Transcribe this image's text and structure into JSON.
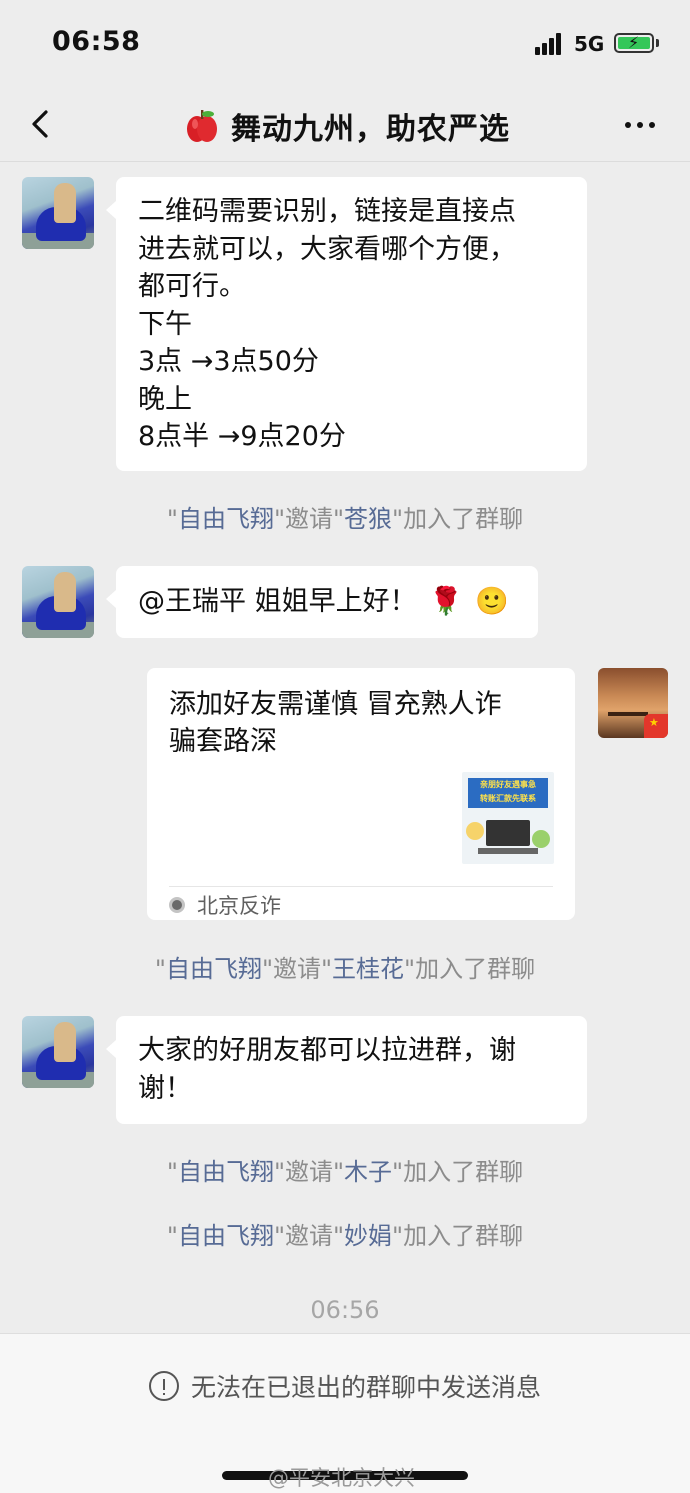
{
  "status_bar": {
    "time": "06:58",
    "network": "5G"
  },
  "nav": {
    "title": "舞动九州，助农严选"
  },
  "messages": {
    "m1_text": "二维码需要识别，链接是直接点\n进去就可以，大家看哪个方便，\n都可行。\n下午\n3点 →3点50分\n晚上\n8点半 →9点20分",
    "m2_text": "@王瑞平 姐姐早上好！",
    "m3_text": "大家的好朋友都可以拉进群，谢\n谢！"
  },
  "system_messages": [
    {
      "inviter": "自由飞翔",
      "invitee": "苍狼"
    },
    {
      "inviter": "自由飞翔",
      "invitee": "王桂花"
    },
    {
      "inviter": "自由飞翔",
      "invitee": "木子"
    },
    {
      "inviter": "自由飞翔",
      "invitee": "妙娟"
    }
  ],
  "system_text": {
    "quote": "\"",
    "invited": "邀请",
    "joined": "加入了群聊"
  },
  "card": {
    "title": "添加好友需谨慎 冒充熟人诈\n骗套路深",
    "source": "北京反诈",
    "thumb_text": "亲朋好友遇事急\n转账汇款先联系"
  },
  "timestamp": "06:56",
  "notice": "无法在已退出的群聊中发送消息",
  "watermark": "@平安北京大兴",
  "emoji": {
    "rose": "🌹",
    "smile": "🙂"
  }
}
